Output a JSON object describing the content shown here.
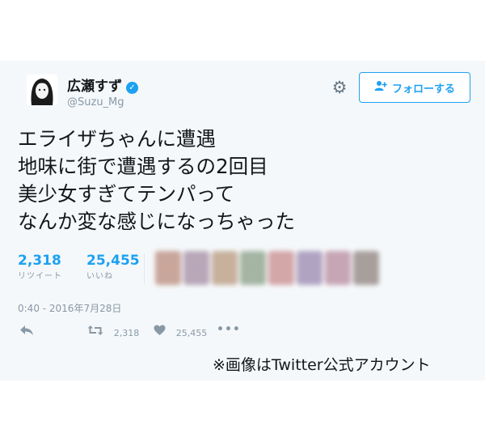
{
  "account": {
    "name": "広瀬すず",
    "handle": "@Suzu_Mg"
  },
  "follow_button": {
    "icon": "person-plus-icon",
    "label": "フォローする"
  },
  "settings_icon": "gear-icon",
  "tweet": {
    "lines": [
      "エライザちゃんに遭遇",
      "地味に街で遭遇するの2回目",
      "美少女すぎてテンパって",
      "なんか変な感じになっちゃった"
    ],
    "retweets": {
      "count": "2,318",
      "label": "リツイート"
    },
    "likes": {
      "count": "25,455",
      "label": "いいね"
    },
    "timestamp": "0:40 - 2016年7月28日"
  },
  "action_bar": {
    "reply_icon": "reply-icon",
    "retweet_icon": "retweet-icon",
    "retweet_count": "2,318",
    "like_icon": "heart-icon",
    "like_count": "25,455",
    "more_icon": "more-icon"
  },
  "caption": "※画像はTwitter公式アカウント",
  "colors": {
    "accent": "#1da1f2",
    "background": "#f5f8fa",
    "text": "#14171a",
    "muted": "#8899a6"
  }
}
